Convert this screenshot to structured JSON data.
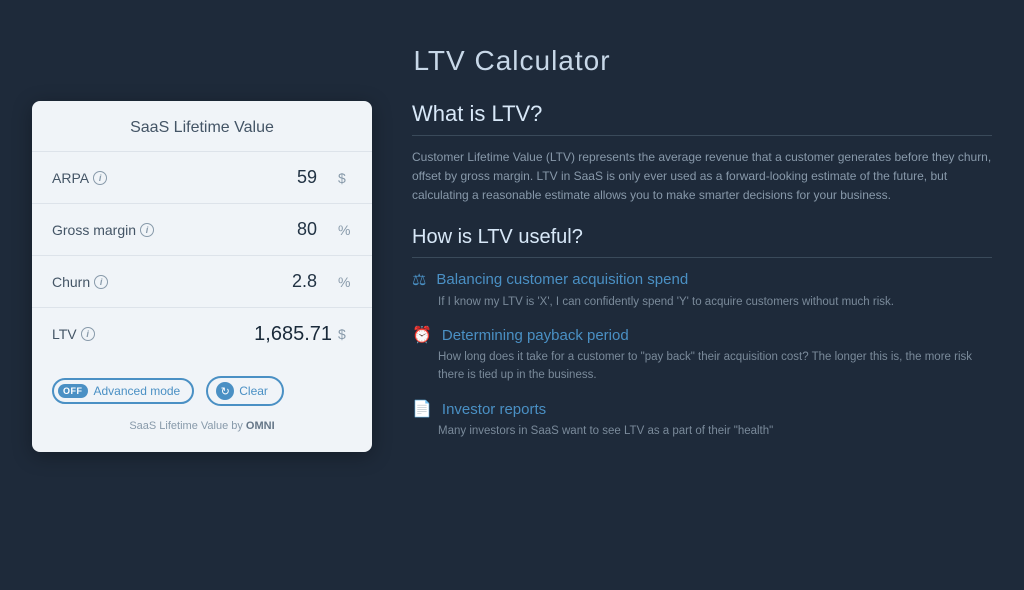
{
  "page": {
    "title": "LTV Calculator"
  },
  "card": {
    "header": "SaaS Lifetime Value",
    "rows": [
      {
        "id": "arpa",
        "label": "ARPA",
        "value": "59",
        "unit": "$"
      },
      {
        "id": "gross-margin",
        "label": "Gross margin",
        "value": "80",
        "unit": "%"
      },
      {
        "id": "churn",
        "label": "Churn",
        "value": "2.8",
        "unit": "%"
      },
      {
        "id": "ltv",
        "label": "LTV",
        "value": "1,685.71",
        "unit": "$",
        "isLtv": true
      }
    ],
    "toggle": {
      "pill_label": "OFF",
      "label": "Advanced mode"
    },
    "clear_button": "Clear",
    "branding": {
      "prefix": "SaaS Lifetime Value by ",
      "brand": "OMNI"
    }
  },
  "info": {
    "what_title": "What is LTV?",
    "what_desc": "Customer Lifetime Value (LTV) represents the average revenue that a customer generates before they churn, offset by gross margin. LTV in SaaS is only ever used as a forward-looking estimate of the future, but calculating a reasonable estimate allows you to make smarter decisions for your business.",
    "how_title": "How is LTV useful?",
    "items": [
      {
        "icon": "⚖",
        "title": "Balancing customer acquisition spend",
        "desc": "If I know my LTV is 'X', I can confidently spend 'Y' to acquire customers without much risk."
      },
      {
        "icon": "⏰",
        "title": "Determining payback period",
        "desc": "How long does it take for a customer to \"pay back\" their acquisition cost? The longer this is, the more risk there is tied up in the business."
      },
      {
        "icon": "📄",
        "title": "Investor reports",
        "desc": "Many investors in SaaS want to see LTV as a part of their \"health\""
      }
    ]
  }
}
